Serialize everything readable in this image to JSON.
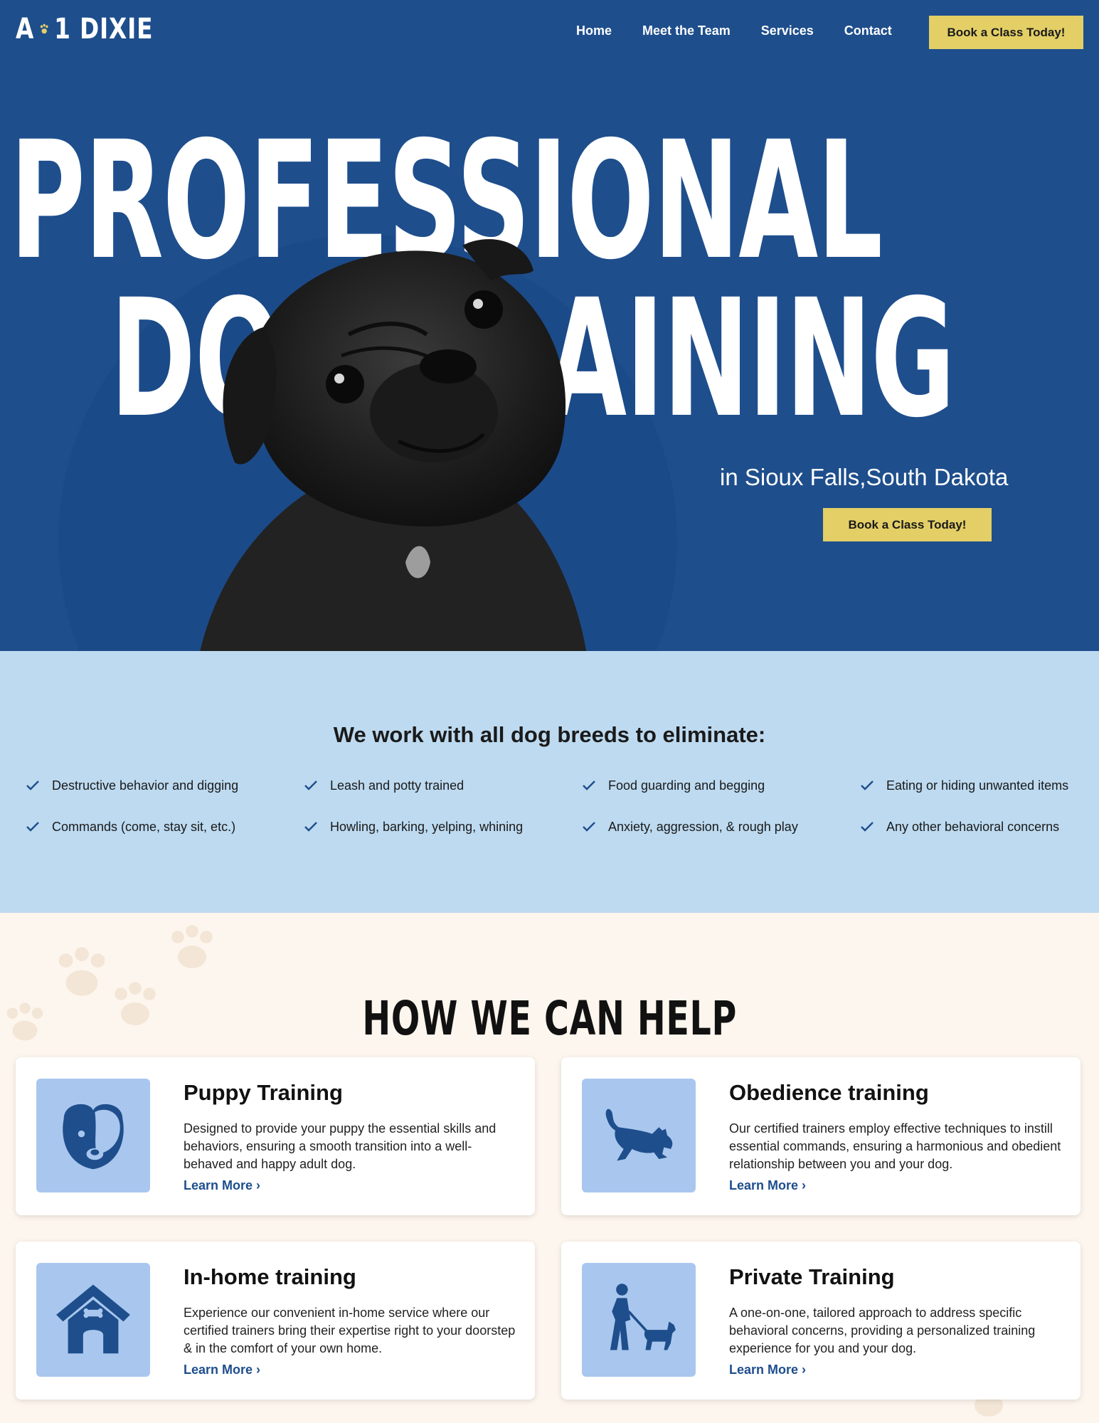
{
  "brand": {
    "logo_left": "A",
    "logo_right": "1 DIXIE"
  },
  "nav": {
    "links": [
      "Home",
      "Meet the Team",
      "Services",
      "Contact"
    ],
    "cta": "Book a Class Today!"
  },
  "hero": {
    "headline_line1": "PROFESSIONAL",
    "headline_line2": "DOG TRAINING",
    "subtitle": "in Sioux Falls,South Dakota",
    "cta": "Book a Class Today!"
  },
  "breeds": {
    "title": "We work with all dog breeds to eliminate:",
    "items": [
      "Destructive behavior and digging",
      "Leash and potty trained",
      "Food guarding and begging",
      "Eating or hiding unwanted items",
      "Commands (come, stay sit, etc.)",
      "Howling, barking, yelping, whining",
      "Anxiety, aggression, & rough play",
      "Any other behavioral concerns"
    ]
  },
  "help": {
    "title": "HOW WE CAN HELP",
    "cards": [
      {
        "title": "Puppy Training",
        "description": "Designed to provide your puppy the essential skills and behaviors, ensuring a smooth transition into a well-behaved and happy adult dog.",
        "link": "Learn More ›",
        "icon": "puppy-head-icon"
      },
      {
        "title": "Obedience training",
        "description": "Our certified trainers employ effective techniques to instill essential commands, ensuring a harmonious and obedient relationship between you and your dog.",
        "link": "Learn More ›",
        "icon": "playing-dog-icon"
      },
      {
        "title": "In-home training",
        "description": "Experience our convenient in-home service where our certified trainers bring their expertise right to your doorstep & in the comfort of your own home.",
        "link": "Learn More ›",
        "icon": "doghouse-icon"
      },
      {
        "title": "Private Training",
        "description": "A one-on-one, tailored approach to address specific behavioral concerns, providing a personalized training experience for you and your dog.",
        "link": "Learn More ›",
        "icon": "person-walking-dog-icon"
      }
    ]
  },
  "colors": {
    "hero_blue": "#1e4e8c",
    "accent_yellow": "#e3cf66",
    "light_blue": "#bddaf0",
    "cream": "#fdf6ee",
    "icon_tile": "#a9c7ee"
  }
}
